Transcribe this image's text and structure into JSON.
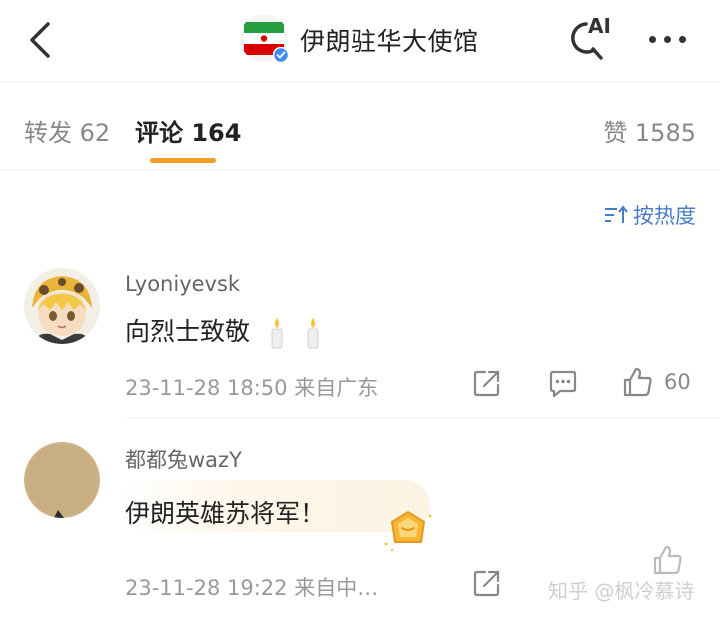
{
  "header": {
    "back_icon": "chevron-left-icon",
    "title": "伊朗驻华大使馆",
    "ai_label": "AI",
    "more_icon": "more-dots-icon"
  },
  "tabs": {
    "repost": "转发 62",
    "comments": "评论 164",
    "likes": "赞 1585"
  },
  "sort": {
    "icon": "sort-icon",
    "label": "按热度"
  },
  "comments": [
    {
      "user": "Lyoniyevsk",
      "text": "向烈士致敬",
      "emoji": "candle-icon",
      "meta": "23-11-28 18:50  来自广东",
      "likes": "60"
    },
    {
      "user": "都都兔wazY",
      "text": "伊朗英雄苏将军！",
      "badge": "gold-gem-badge-icon",
      "meta": "23-11-28 19:22  来自中…"
    }
  ],
  "watermark": "知乎 @枫冷慕诗",
  "colors": {
    "accent": "#f59d24",
    "link": "#4a7cc6",
    "verified": "#3b8cf5"
  }
}
